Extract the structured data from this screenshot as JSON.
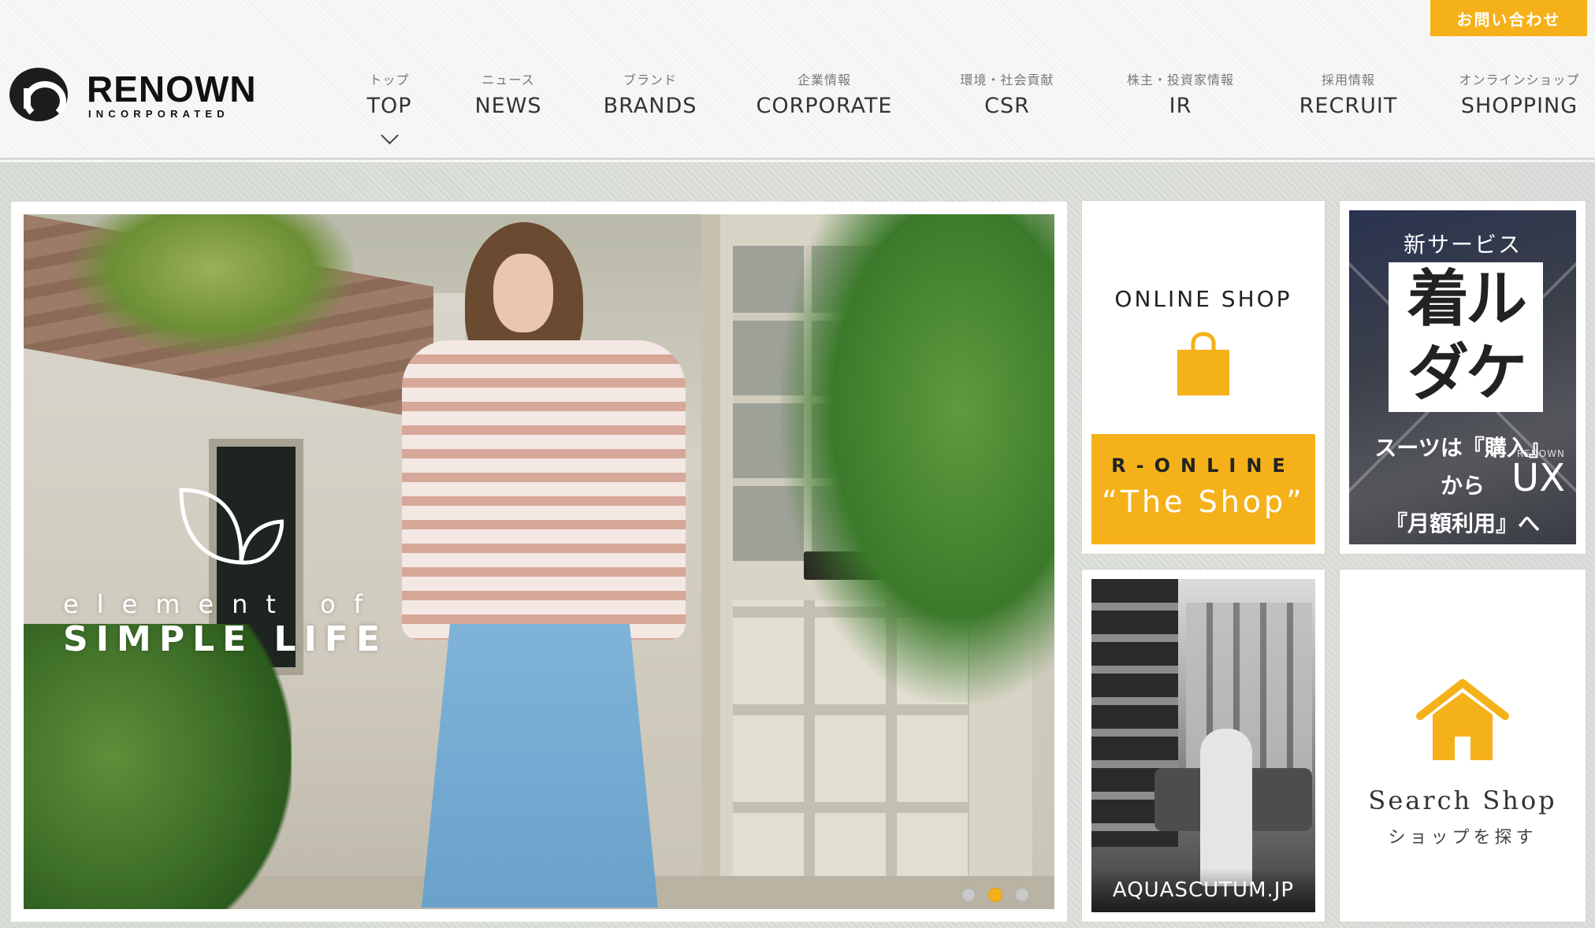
{
  "header": {
    "contact_label": "お問い合わせ",
    "logo": {
      "main": "RENOWN",
      "sub": "INCORPORATED"
    },
    "nav": [
      {
        "jp": "トップ",
        "en": "TOP"
      },
      {
        "jp": "ニュース",
        "en": "NEWS"
      },
      {
        "jp": "ブランド",
        "en": "BRANDS"
      },
      {
        "jp": "企業情報",
        "en": "CORPORATE"
      },
      {
        "jp": "環境・社会貢献",
        "en": "CSR"
      },
      {
        "jp": "株主・投資家情報",
        "en": "IR"
      },
      {
        "jp": "採用情報",
        "en": "RECRUIT"
      },
      {
        "jp": "オンラインショップ",
        "en": "SHOPPING"
      }
    ]
  },
  "hero": {
    "tag_small": "element of",
    "tag_big": "SIMPLE LIFE",
    "slides_count": 3,
    "active_slide": 2
  },
  "cards": {
    "online_shop": {
      "title": "ONLINE SHOP",
      "brand": "R-ONLINE",
      "tagline": "“The Shop”"
    },
    "kiru": {
      "new_label": "新サービス",
      "title_line1": "着ル",
      "title_line2": "ダケ",
      "ux_small": "RENOWN",
      "ux_big": "UX",
      "copy_line1": "スーツは『購入』",
      "copy_line2": "から",
      "copy_line3": "『月額利用』へ"
    },
    "aquascutum": {
      "label": "AQUASCUTUM.JP"
    },
    "search_shop": {
      "title": "Search Shop",
      "subtitle": "ショップを探す"
    }
  },
  "colors": {
    "accent": "#f5b11a",
    "text_dark": "#222222",
    "nav_sub": "#777777"
  },
  "icons": [
    "renown-logo-icon",
    "chevron-down-icon",
    "leaf-icon",
    "shopping-bag-icon",
    "house-icon"
  ]
}
